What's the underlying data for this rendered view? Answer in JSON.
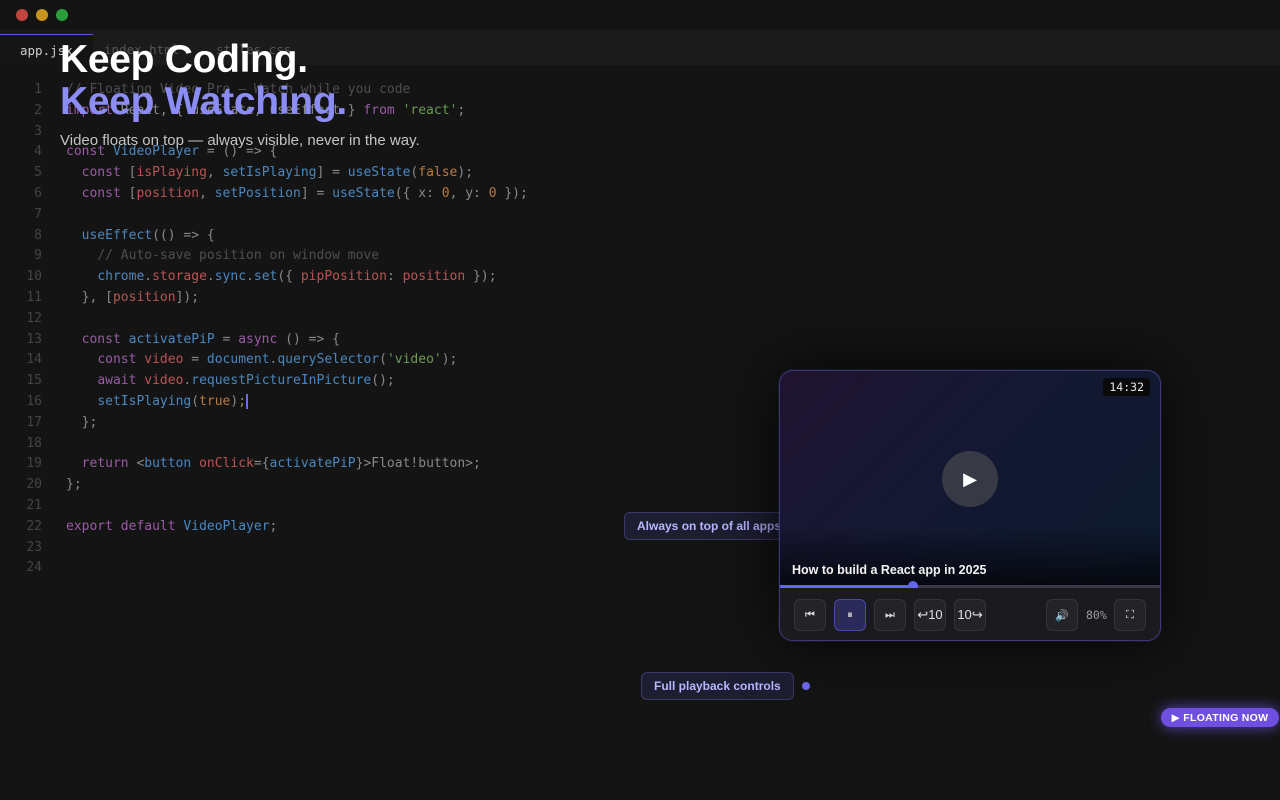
{
  "window": {
    "controls": [
      "close",
      "minimize",
      "maximize"
    ]
  },
  "tabs": [
    {
      "label": "app.jsx",
      "active": true
    },
    {
      "label": "index.html",
      "active": false
    },
    {
      "label": "styles.css",
      "active": false
    }
  ],
  "hero": {
    "title_line1": "Keep Coding.",
    "title_line2": "Keep Watching.",
    "subtitle": "Video floats on top — always visible, never in the way."
  },
  "editor": {
    "lines": [
      {
        "num": "1",
        "tokens": [
          [
            "c",
            "// Floating Video Pro — Watch while you code"
          ]
        ]
      },
      {
        "num": "2",
        "tokens": [
          [
            "k",
            "import"
          ],
          [
            "p",
            " React, { useState, useEffect } "
          ],
          [
            "k",
            "from"
          ],
          [
            "p",
            " "
          ],
          [
            "s",
            "'react'"
          ],
          [
            "p",
            ";"
          ]
        ]
      },
      {
        "num": "3",
        "tokens": []
      },
      {
        "num": "4",
        "tokens": [
          [
            "k",
            "const"
          ],
          [
            "p",
            " "
          ],
          [
            "f",
            "VideoPlayer"
          ],
          [
            "p",
            " = () => {"
          ]
        ]
      },
      {
        "num": "5",
        "tokens": [
          [
            "p",
            "  "
          ],
          [
            "k",
            "const"
          ],
          [
            "p",
            " ["
          ],
          [
            "v",
            "isPlaying"
          ],
          [
            "p",
            ", "
          ],
          [
            "f",
            "setIsPlaying"
          ],
          [
            "p",
            "] = "
          ],
          [
            "f",
            "useState"
          ],
          [
            "p",
            "("
          ],
          [
            "n",
            "false"
          ],
          [
            "p",
            ");"
          ]
        ]
      },
      {
        "num": "6",
        "tokens": [
          [
            "p",
            "  "
          ],
          [
            "k",
            "const"
          ],
          [
            "p",
            " ["
          ],
          [
            "v",
            "position"
          ],
          [
            "p",
            ", "
          ],
          [
            "f",
            "setPosition"
          ],
          [
            "p",
            "] = "
          ],
          [
            "f",
            "useState"
          ],
          [
            "p",
            "({ x: "
          ],
          [
            "n",
            "0"
          ],
          [
            "p",
            ", y: "
          ],
          [
            "n",
            "0"
          ],
          [
            "p",
            " });"
          ]
        ]
      },
      {
        "num": "7",
        "tokens": []
      },
      {
        "num": "8",
        "tokens": [
          [
            "p",
            "  "
          ],
          [
            "f",
            "useEffect"
          ],
          [
            "p",
            "(() => {"
          ]
        ]
      },
      {
        "num": "9",
        "tokens": [
          [
            "p",
            "    "
          ],
          [
            "c",
            "// Auto-save position on window move"
          ]
        ]
      },
      {
        "num": "10",
        "tokens": [
          [
            "p",
            "    "
          ],
          [
            "f",
            "chrome"
          ],
          [
            "p",
            "."
          ],
          [
            "v",
            "storage"
          ],
          [
            "p",
            "."
          ],
          [
            "f",
            "sync"
          ],
          [
            "p",
            "."
          ],
          [
            "f",
            "set"
          ],
          [
            "p",
            "({ "
          ],
          [
            "v",
            "pipPosition"
          ],
          [
            "p",
            ": "
          ],
          [
            "v",
            "position"
          ],
          [
            "p",
            " });"
          ]
        ]
      },
      {
        "num": "11",
        "tokens": [
          [
            "p",
            "  }, ["
          ],
          [
            "v",
            "position"
          ],
          [
            "p",
            "]);"
          ]
        ]
      },
      {
        "num": "12",
        "tokens": []
      },
      {
        "num": "13",
        "tokens": [
          [
            "p",
            "  "
          ],
          [
            "k",
            "const"
          ],
          [
            "p",
            " "
          ],
          [
            "f",
            "activatePiP"
          ],
          [
            "p",
            " = "
          ],
          [
            "k",
            "async"
          ],
          [
            "p",
            " () => {"
          ]
        ]
      },
      {
        "num": "14",
        "tokens": [
          [
            "p",
            "    "
          ],
          [
            "k",
            "const"
          ],
          [
            "p",
            " "
          ],
          [
            "v",
            "video"
          ],
          [
            "p",
            " = "
          ],
          [
            "f",
            "document"
          ],
          [
            "p",
            "."
          ],
          [
            "f",
            "querySelector"
          ],
          [
            "p",
            "("
          ],
          [
            "s",
            "'video'"
          ],
          [
            "p",
            ");"
          ]
        ]
      },
      {
        "num": "15",
        "tokens": [
          [
            "p",
            "    "
          ],
          [
            "k",
            "await"
          ],
          [
            "p",
            " "
          ],
          [
            "v",
            "video"
          ],
          [
            "p",
            "."
          ],
          [
            "f",
            "requestPictureInPicture"
          ],
          [
            "p",
            "();"
          ]
        ]
      },
      {
        "num": "16",
        "tokens": [
          [
            "p",
            "    "
          ],
          [
            "f",
            "setIsPlaying"
          ],
          [
            "p",
            "("
          ],
          [
            "n",
            "true"
          ],
          [
            "p",
            ");"
          ]
        ],
        "cursor": true
      },
      {
        "num": "17",
        "tokens": [
          [
            "p",
            "  };"
          ]
        ]
      },
      {
        "num": "18",
        "tokens": []
      },
      {
        "num": "19",
        "tokens": [
          [
            "p",
            "  "
          ],
          [
            "k",
            "return"
          ],
          [
            "p",
            " <"
          ],
          [
            "f",
            "button"
          ],
          [
            "p",
            " "
          ],
          [
            "v",
            "onClick"
          ],
          [
            "p",
            "={"
          ],
          [
            "f",
            "activatePiP"
          ],
          [
            "p",
            "}>Float!button>;"
          ]
        ]
      },
      {
        "num": "20",
        "tokens": [
          [
            "p",
            "};"
          ]
        ]
      },
      {
        "num": "21",
        "tokens": []
      },
      {
        "num": "22",
        "tokens": [
          [
            "k",
            "export"
          ],
          [
            "p",
            " "
          ],
          [
            "k",
            "default"
          ],
          [
            "p",
            " "
          ],
          [
            "f",
            "VideoPlayer"
          ],
          [
            "p",
            ";"
          ]
        ]
      },
      {
        "num": "23",
        "tokens": []
      },
      {
        "num": "24",
        "tokens": []
      }
    ]
  },
  "player": {
    "duration": "14:32",
    "video_title": "How to build a React app in 2025",
    "progress": 0.35,
    "volume_label": "80%",
    "buttons": {
      "prev": "⏮",
      "pause": "⏸",
      "next": "⏭",
      "rewind": "↩10",
      "forward": "10↪",
      "volume": "🔊",
      "fullscreen": "⛶",
      "play": "▶"
    }
  },
  "callouts": {
    "always_on_top": "Always on top of all apps",
    "controls": "Full playback controls"
  },
  "badge": {
    "label": "▶ FLOATING NOW"
  },
  "colors": {
    "accent": "#6366f1",
    "accent_text": "#8b8cf4",
    "badge": "#6f4fe0",
    "background": "#141414"
  }
}
